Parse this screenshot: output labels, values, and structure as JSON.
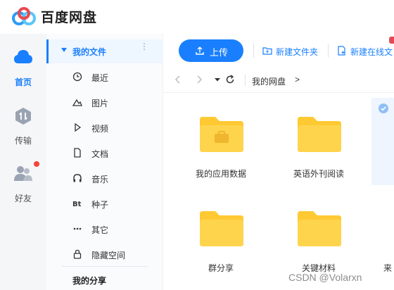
{
  "app": {
    "name": "百度网盘"
  },
  "rail": [
    {
      "label": "首页",
      "icon": "cloud-icon",
      "active": true
    },
    {
      "label": "传输",
      "icon": "transfer-icon"
    },
    {
      "label": "好友",
      "icon": "friends-icon",
      "has_notification": true
    }
  ],
  "categories": {
    "header": "我的文件",
    "more": "⋮",
    "items": [
      {
        "label": "最近",
        "icon": "clock-icon"
      },
      {
        "label": "图片",
        "icon": "image-icon"
      },
      {
        "label": "视频",
        "icon": "play-icon"
      },
      {
        "label": "文档",
        "icon": "document-icon"
      },
      {
        "label": "音乐",
        "icon": "headphones-icon"
      },
      {
        "label": "种子",
        "icon": "bt-icon"
      },
      {
        "label": "其它",
        "icon": "more-dots-icon"
      },
      {
        "label": "隐藏空间",
        "icon": "lock-icon"
      }
    ],
    "share_title": "我的分享"
  },
  "toolbar": {
    "upload_label": "上传",
    "new_folder_label": "新建文件夹",
    "new_online_doc_label": "新建在线文"
  },
  "nav": {
    "breadcrumb": "我的网盘",
    "breadcrumb_arrow": ">"
  },
  "files": [
    {
      "name": "我的应用数据",
      "type": "folder-with-box"
    },
    {
      "name": "英语外刊阅读",
      "type": "folder"
    },
    {
      "name": "群分享",
      "type": "folder"
    },
    {
      "name": "关键材料",
      "type": "folder"
    },
    {
      "name": "来",
      "type": "folder",
      "selected": true
    }
  ],
  "watermark": "CSDN @Volarxn",
  "colors": {
    "accent": "#1a7ffe",
    "folder": "#ffd44d",
    "folder_tab": "#ffc933",
    "notification": "#f4433a"
  }
}
